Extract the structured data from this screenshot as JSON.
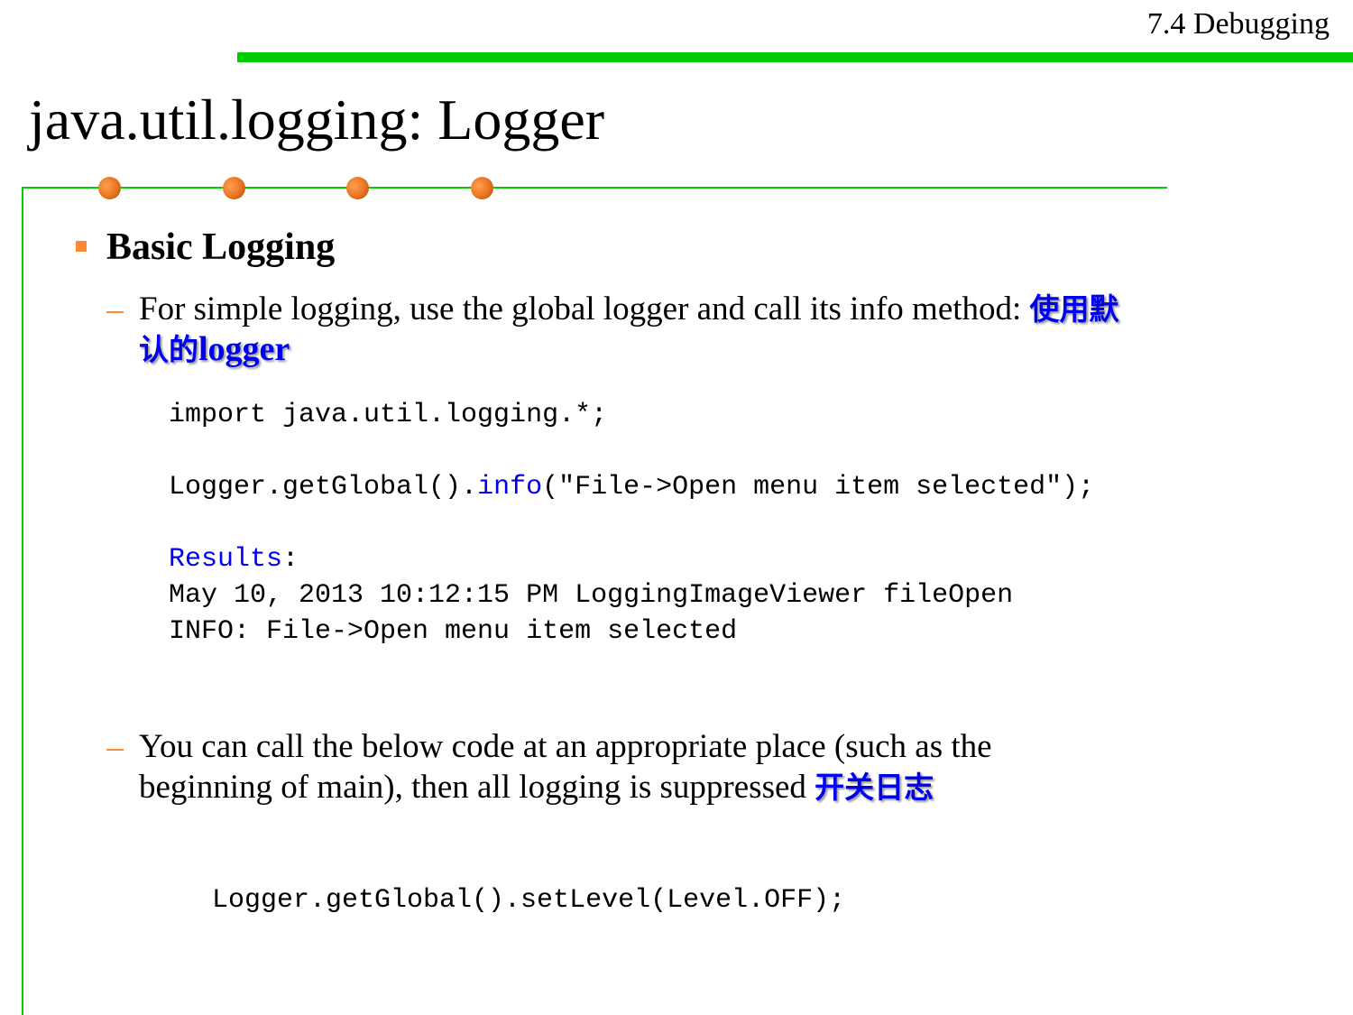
{
  "header": {
    "section": "7.4 Debugging"
  },
  "title": "java.util.logging: Logger",
  "heading": "Basic Logging",
  "bullet1": {
    "line1": "For simple logging, use the global logger and call its info method: ",
    "line1_cn": "使用默",
    "line2_cn": "认的",
    "line2_en": "logger"
  },
  "code1": {
    "import": "import java.util.logging.*;",
    "call_prefix": "Logger.getGlobal().",
    "call_method": "info",
    "call_suffix": "(\"File->Open menu item selected\");",
    "results_label": "Results",
    "results_colon": ":",
    "result_line1": "May 10, 2013 10:12:15 PM LoggingImageViewer fileOpen",
    "result_line2": "INFO: File->Open menu item selected"
  },
  "bullet2": {
    "line1": "You can call  the below code at an appropriate place (such as the",
    "line2": "beginning of main), then all logging is suppressed  ",
    "line2_cn": "开关日志"
  },
  "code2": "Logger.getGlobal().setLevel(Level.OFF);"
}
